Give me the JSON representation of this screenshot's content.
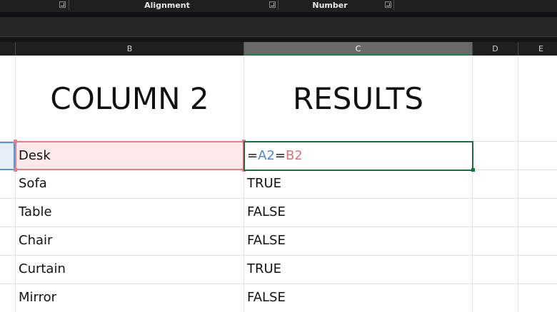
{
  "ribbon": {
    "groups": [
      {
        "label": ""
      },
      {
        "label": "Alignment"
      },
      {
        "label": "Number"
      }
    ]
  },
  "columns": [
    {
      "letter": "",
      "selected": false
    },
    {
      "letter": "B",
      "selected": false
    },
    {
      "letter": "C",
      "selected": true
    },
    {
      "letter": "D",
      "selected": false
    },
    {
      "letter": "E",
      "selected": false
    }
  ],
  "sheet": {
    "header_row": {
      "b": "COLUMN 2",
      "c": "RESULTS"
    },
    "rows": [
      {
        "b": "Desk",
        "c": ""
      },
      {
        "b": "Sofa",
        "c": "TRUE"
      },
      {
        "b": "Table",
        "c": "FALSE"
      },
      {
        "b": "Chair",
        "c": "FALSE"
      },
      {
        "b": "Curtain",
        "c": "TRUE"
      },
      {
        "b": "Mirror",
        "c": "FALSE"
      }
    ],
    "active_formula": {
      "eq1": "=",
      "ref1": "A2",
      "eq2": "=",
      "ref2": "B2"
    }
  },
  "colors": {
    "accent_green": "#1d6b40",
    "ref_blue": "#4a86d4",
    "ref_red": "#e07179"
  }
}
